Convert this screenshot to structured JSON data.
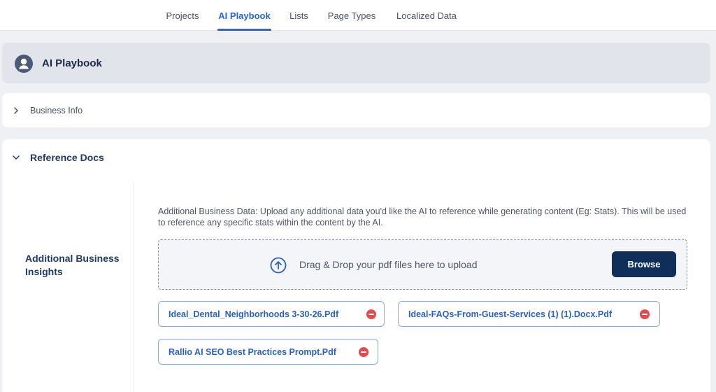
{
  "topnav": {
    "tabs": [
      {
        "label": "Projects",
        "active": false
      },
      {
        "label": "AI Playbook",
        "active": true
      },
      {
        "label": "Lists",
        "active": false
      },
      {
        "label": "Page Types",
        "active": false
      },
      {
        "label": "Localized Data",
        "active": false
      }
    ]
  },
  "header": {
    "title": "AI Playbook",
    "icon": "user-avatar-icon"
  },
  "sections": {
    "business_info": {
      "label": "Business Info",
      "expanded": false
    },
    "reference_docs": {
      "label": "Reference Docs",
      "expanded": true
    }
  },
  "insights": {
    "label": "Additional Business Insights",
    "description": "Additional Business Data: Upload any additional data you'd like the AI to reference while generating content (Eg: Stats). This will be used to reference any specific stats within the content by the AI.",
    "dropzone_text": "Drag & Drop your pdf files here to upload",
    "browse_label": "Browse",
    "files": [
      {
        "name": "Ideal_Dental_Neighborhoods 3-30-26.Pdf"
      },
      {
        "name": "Ideal-FAQs-From-Guest-Services (1) (1).Docx.Pdf"
      },
      {
        "name": "Rallio AI SEO Best Practices Prompt.Pdf"
      }
    ]
  },
  "colors": {
    "accent": "#2463d9",
    "primary_button": "#0f2e5a",
    "remove": "#e5484d"
  }
}
